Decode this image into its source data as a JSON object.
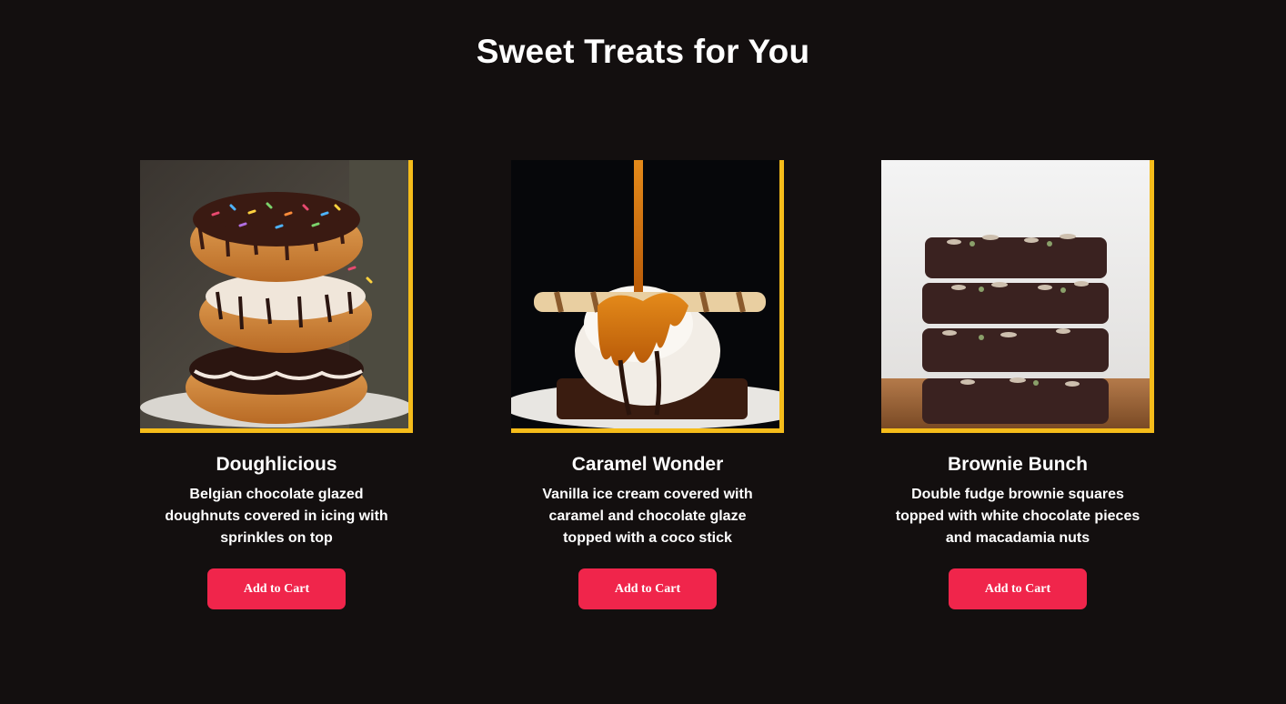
{
  "page": {
    "title": "Sweet Treats for You"
  },
  "colors": {
    "background": "#130f0f",
    "accent_border": "#f5bc1a",
    "button": "#f0254b",
    "text": "#ffffff"
  },
  "products": [
    {
      "name": "Doughlicious",
      "description": "Belgian chocolate glazed doughnuts covered in icing with sprinkles on top",
      "button_label": "Add to Cart",
      "image_subject": "stacked-doughnuts"
    },
    {
      "name": "Caramel Wonder",
      "description": "Vanilla ice cream covered with caramel and chocolate glaze topped with a coco stick",
      "button_label": "Add to Cart",
      "image_subject": "ice-cream-caramel"
    },
    {
      "name": "Brownie Bunch",
      "description": "Double fudge brownie squares topped with white chocolate pieces and macadamia nuts",
      "button_label": "Add to Cart",
      "image_subject": "stacked-brownies"
    }
  ]
}
